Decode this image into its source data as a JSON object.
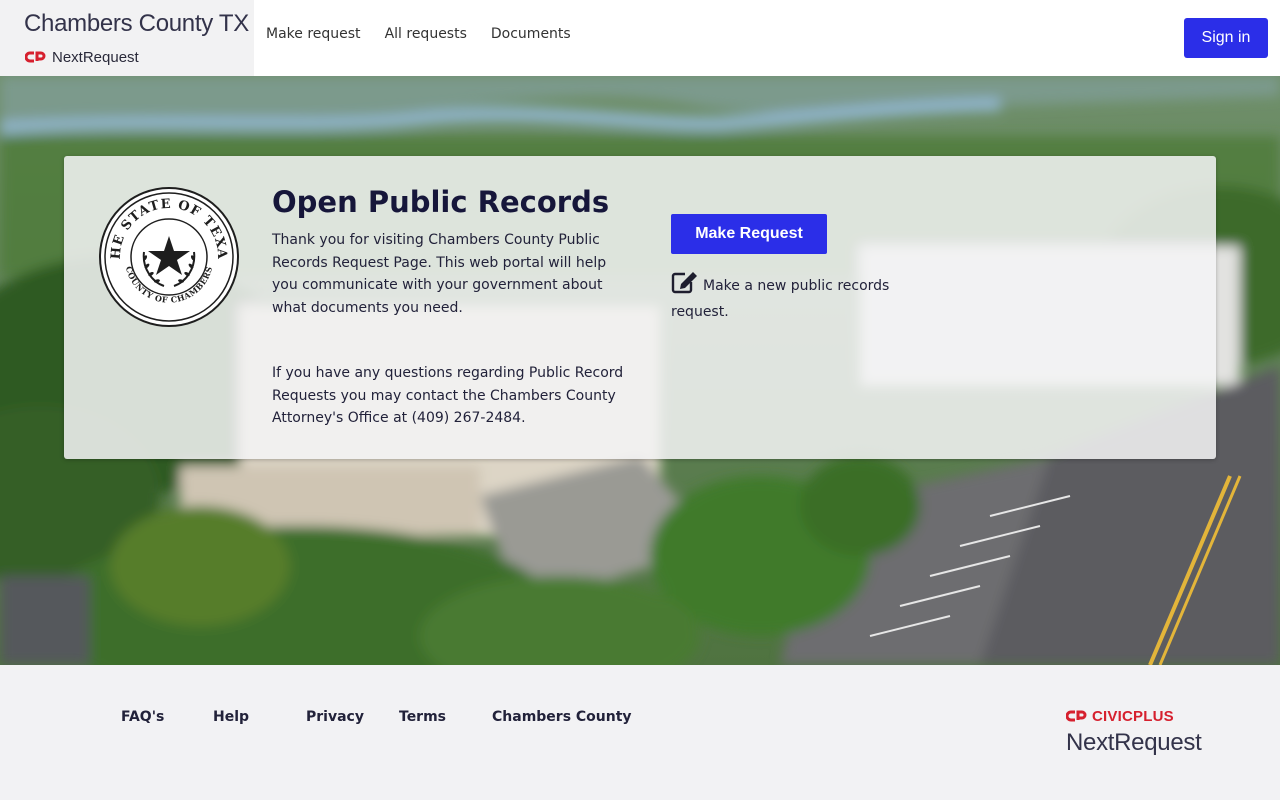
{
  "header": {
    "brand_title": "Chambers County TX",
    "brand_product": "NextRequest",
    "nav": [
      {
        "label": "Make request"
      },
      {
        "label": "All requests"
      },
      {
        "label": "Documents"
      }
    ],
    "sign_in_label": "Sign in"
  },
  "card": {
    "seal_top_text": "THE STATE OF TEXAS",
    "seal_bottom_text": "COUNTY OF CHAMBERS",
    "title": "Open Public Records",
    "paragraph1": "Thank you for visiting Chambers County Public Records Request Page. This web portal will help you communicate with your government about what documents you need.",
    "paragraph2": "If you have any questions regarding Public Record Requests you may contact the Chambers County Attorney's Office at (409) 267-2484.",
    "make_request_label": "Make Request",
    "new_request_text": "Make a new public records request."
  },
  "footer": {
    "links": [
      {
        "label": "FAQ's"
      },
      {
        "label": "Help"
      },
      {
        "label": "Privacy"
      },
      {
        "label": "Terms"
      },
      {
        "label": "Chambers County"
      }
    ],
    "civicplus_label": "CIVICPLUS",
    "nextrequest_label": "NextRequest"
  },
  "colors": {
    "accent": "#2b2ee8",
    "brand_red": "#d6202e",
    "text_dark": "#16163a"
  },
  "icons": {
    "brand": "nextrequest-logo-icon",
    "edit": "edit-icon",
    "seal": "texas-seal-icon"
  }
}
